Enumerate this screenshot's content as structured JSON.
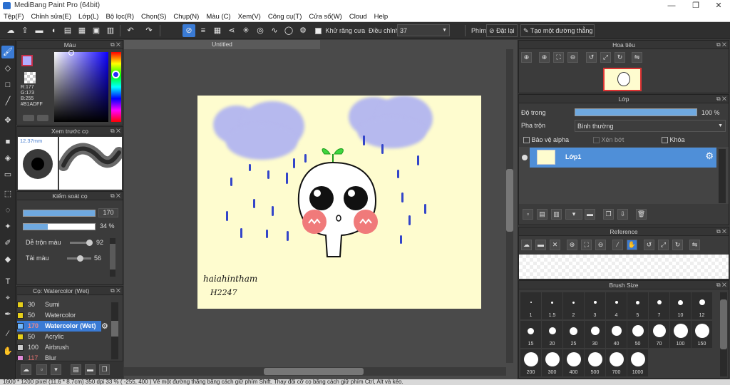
{
  "app": {
    "title": "MediBang Paint Pro (64bit)"
  },
  "window": {
    "minimize": "—",
    "maximize": "❐",
    "close": "✕"
  },
  "menu": [
    "Tệp(F)",
    "Chỉnh sửa(E)",
    "Lớp(L)",
    "Bộ lọc(R)",
    "Chọn(S)",
    "Chụp(N)",
    "Màu (C)",
    "Xem(V)",
    "Công cụ(T)",
    "Cửa sổ(W)",
    "Cloud",
    "Help"
  ],
  "toolbar": {
    "antialias_label": "Khử răng cưa",
    "adjust_label": "Điều chỉnh",
    "adjust_value": "37",
    "keys_label": "Phím",
    "reset_label": "Đặt lại",
    "guide_label": "Tạo một đường thẳng"
  },
  "color_panel": {
    "title": "Màu",
    "r": "R:177",
    "g": "G:173",
    "b": "B:255",
    "hex": "#B1ADFF",
    "primary": "#b1adff"
  },
  "brush_preview": {
    "title": "Xem trước cọ",
    "size": "12.37mm"
  },
  "brush_control": {
    "title": "Kiểm soát cọ",
    "size": "170",
    "opacity": "34 %",
    "mix_label": "Dễ trộn màu",
    "mix_value": "92",
    "reload_label": "Tải màu",
    "reload_value": "56",
    "opacity_fraction": 0.34,
    "mix_fraction": 0.92,
    "reload_fraction": 0.56
  },
  "brush_list": {
    "title": "Cọ: Watercolor (Wet)",
    "items": [
      {
        "size": "30",
        "name": "Sumi",
        "color": "#e6cf1a"
      },
      {
        "size": "50",
        "name": "Watercolor",
        "color": "#e6cf1a"
      },
      {
        "size": "170",
        "name": "Watercolor (Wet)",
        "color": "#6fb7ff"
      },
      {
        "size": "50",
        "name": "Acrylic",
        "color": "#e6cf1a"
      },
      {
        "size": "100",
        "name": "Airbrush",
        "color": "#cccccc"
      },
      {
        "size": "117",
        "name": "Blur",
        "color": "#e28ad8"
      }
    ]
  },
  "document": {
    "tab": "Untitled"
  },
  "artwork": {
    "signature": "haiahintham",
    "signature_sub": "H2247"
  },
  "navigator": {
    "title": "Hoa tiêu"
  },
  "layer_panel": {
    "title": "Lớp",
    "opacity_label": "Độ trong",
    "opacity_value": "100 %",
    "opacity_fraction": 1.0,
    "blend_label": "Pha trộn",
    "blend_value": "Bình thường",
    "protect_alpha": "Bảo vệ alpha",
    "clipping": "Xén bớt",
    "lock": "Khóa",
    "layer_name": "Lớp1"
  },
  "reference": {
    "title": "Reference"
  },
  "brush_size": {
    "title": "Brush Size",
    "sizes": [
      "1",
      "1.5",
      "2",
      "3",
      "4",
      "5",
      "7",
      "10",
      "12",
      "15",
      "20",
      "25",
      "30",
      "40",
      "50",
      "70",
      "100",
      "150",
      "200",
      "300",
      "400",
      "500",
      "700",
      "1000"
    ]
  },
  "status": {
    "text": "1600 * 1200 pixel  (11.6 * 8.7cm)  350 dpi  33 %  ( -255, 400 )  Vẽ một đường thẳng bằng cách giữ phím Shift. Thay đổi cỡ cọ bằng cách giữ phím Ctrl, Alt và kéo."
  }
}
